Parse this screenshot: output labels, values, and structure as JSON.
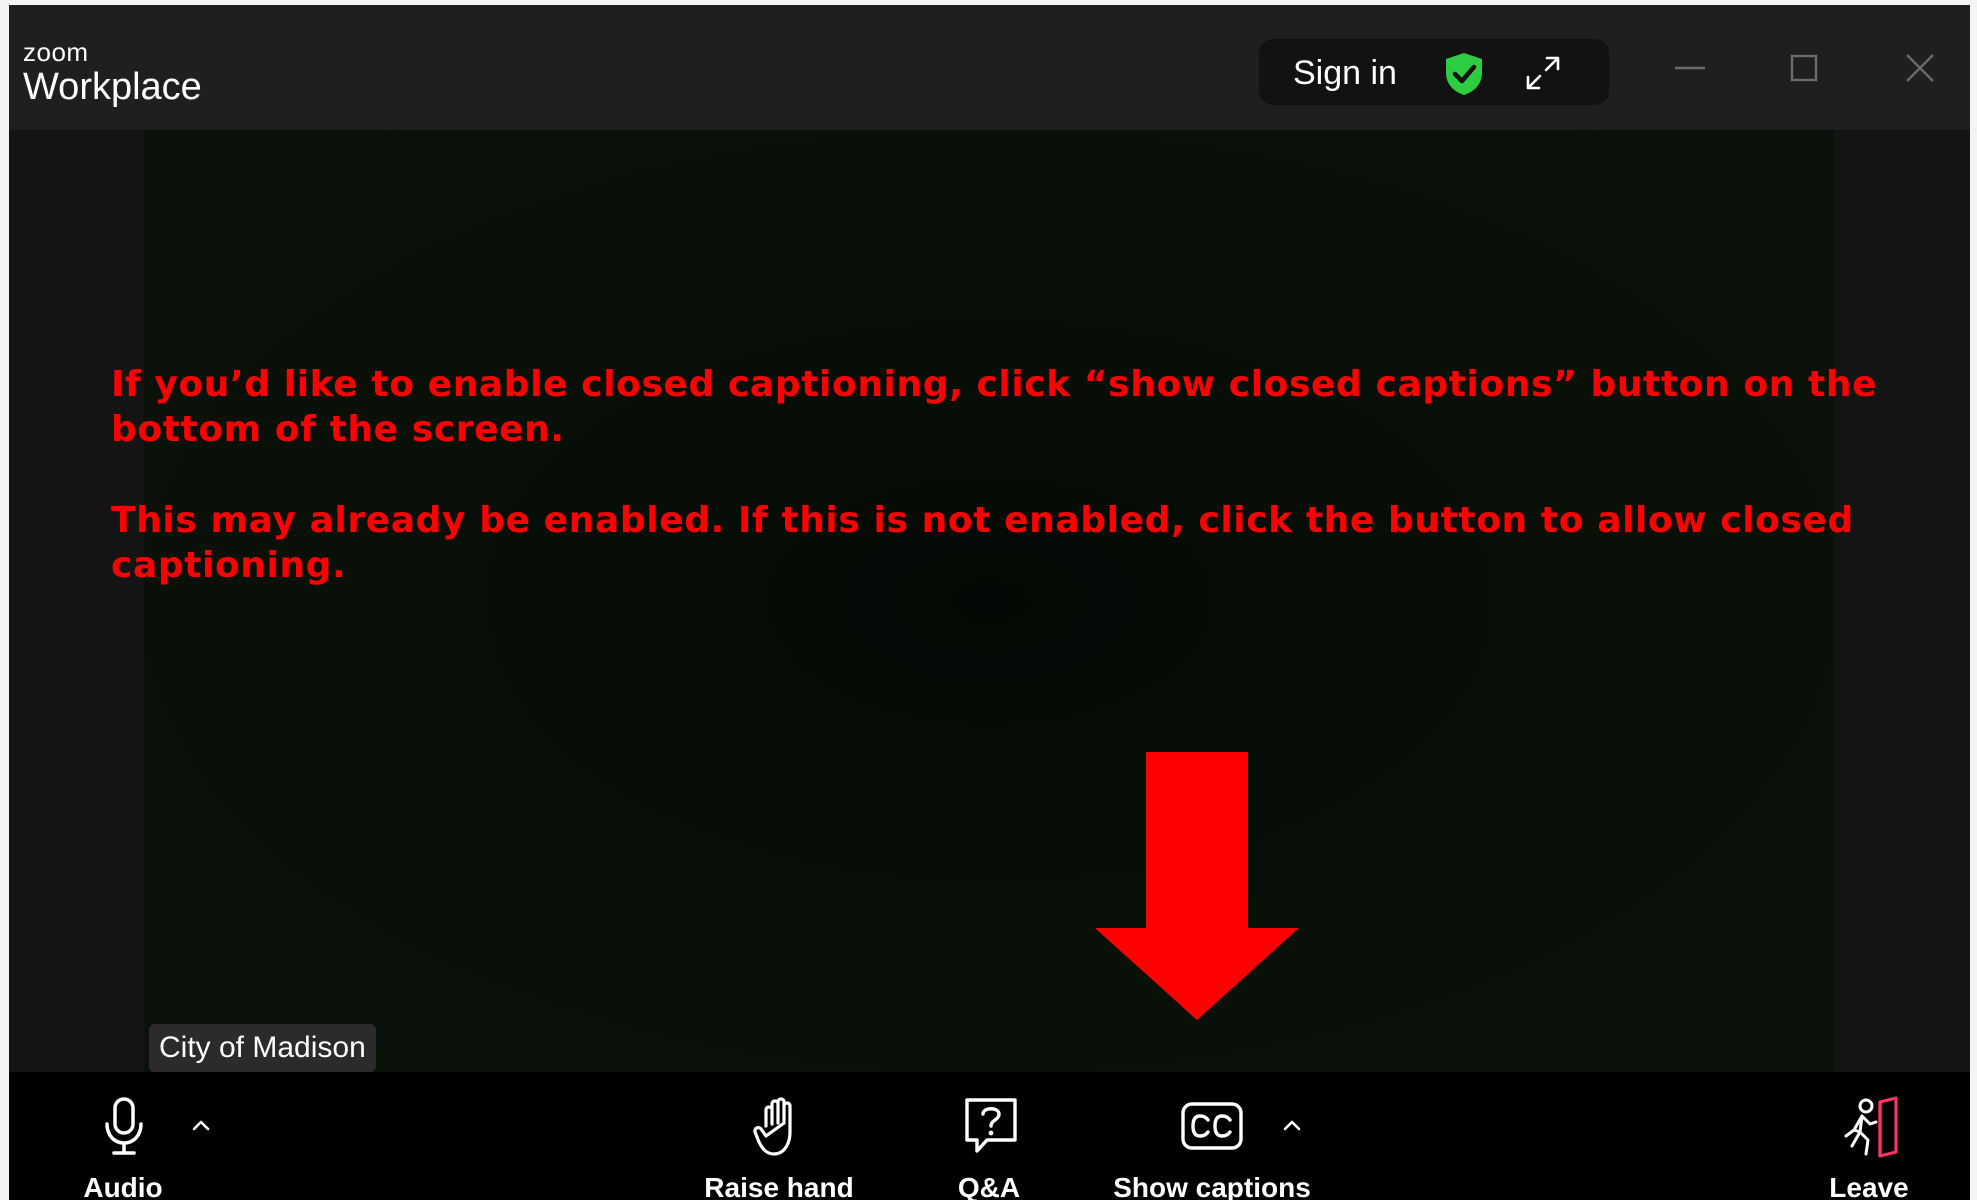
{
  "window": {
    "brand_small": "zoom",
    "brand_big": "Workplace",
    "sign_in_label": "Sign in"
  },
  "stage": {
    "instruction_1": "If you’d like to enable closed captioning, click “show closed captions” button on the bottom of the screen.",
    "instruction_2": "This may already be enabled. If this is not enabled, click the button to allow closed captioning.",
    "participant_name": "City of Madison"
  },
  "toolbar": {
    "audio_label": "Audio",
    "raise_hand_label": "Raise hand",
    "qa_label": "Q&A",
    "captions_label": "Show captions",
    "leave_label": "Leave"
  },
  "colors": {
    "annotation": "#ff0000",
    "shield": "#2ecc40",
    "leave_accent": "#ff3366"
  },
  "icons": [
    "shield-check-icon",
    "expand-icon",
    "minimize-icon",
    "maximize-icon",
    "close-icon",
    "microphone-icon",
    "chevron-up-icon",
    "raise-hand-icon",
    "question-bubble-icon",
    "cc-icon",
    "leave-icon",
    "arrow-down-icon"
  ]
}
